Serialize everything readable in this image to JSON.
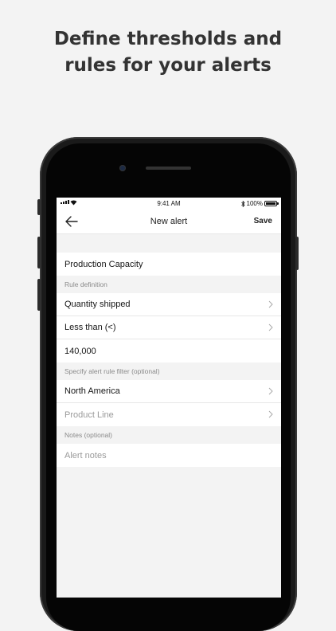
{
  "headline": {
    "line1": "Define thresholds and",
    "line2": "rules for your alerts"
  },
  "status_bar": {
    "time": "9:41 AM",
    "battery": "100%"
  },
  "nav": {
    "title": "New alert",
    "save_label": "Save",
    "back_icon": "arrow-left-icon"
  },
  "form": {
    "alert_name": "Production Capacity",
    "rule_section_label": "Rule definition",
    "metric": "Quantity shipped",
    "operator": "Less than (<)",
    "threshold": "140,000",
    "filter_section_label": "Specify alert rule filter (optional)",
    "region": "North America",
    "product_line_placeholder": "Product Line",
    "notes_section_label": "Notes (optional)",
    "notes_placeholder": "Alert notes"
  },
  "colors": {
    "background": "#f3f3f3",
    "headline": "#333333",
    "phone_body": "#1a1a1a",
    "row_background": "#ffffff",
    "placeholder_text": "#9a9a9a",
    "section_label": "#8a8a8a"
  }
}
